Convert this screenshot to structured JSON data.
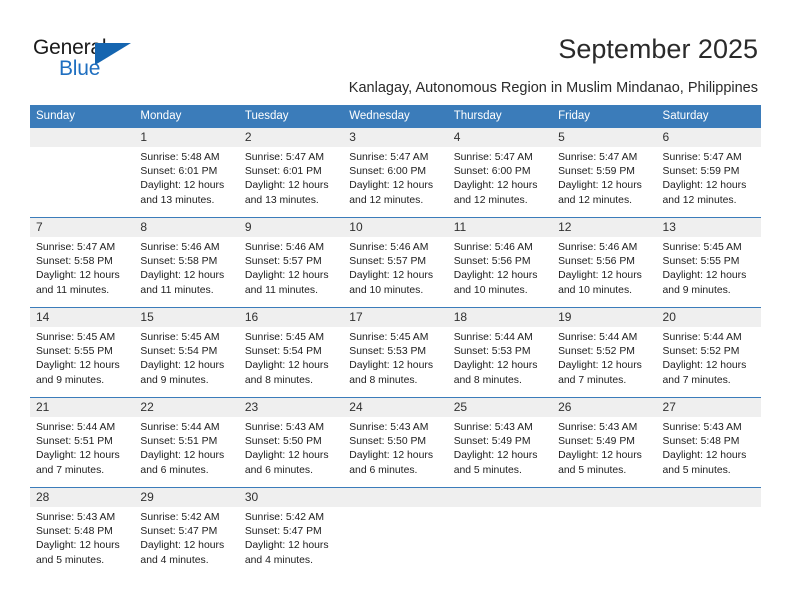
{
  "brand": {
    "name_part1": "General",
    "name_part2": "Blue"
  },
  "header": {
    "title": "September 2025",
    "subtitle": "Kanlagay, Autonomous Region in Muslim Mindanao, Philippines"
  },
  "colors": {
    "header_blue": "#3b7cba",
    "logo_blue": "#1f6fc0",
    "daynum_band": "#efefef"
  },
  "weekday_headers": [
    "Sunday",
    "Monday",
    "Tuesday",
    "Wednesday",
    "Thursday",
    "Friday",
    "Saturday"
  ],
  "weeks": [
    [
      {
        "day": "",
        "lines": []
      },
      {
        "day": "1",
        "lines": [
          "Sunrise: 5:48 AM",
          "Sunset: 6:01 PM",
          "Daylight: 12 hours",
          "and 13 minutes."
        ]
      },
      {
        "day": "2",
        "lines": [
          "Sunrise: 5:47 AM",
          "Sunset: 6:01 PM",
          "Daylight: 12 hours",
          "and 13 minutes."
        ]
      },
      {
        "day": "3",
        "lines": [
          "Sunrise: 5:47 AM",
          "Sunset: 6:00 PM",
          "Daylight: 12 hours",
          "and 12 minutes."
        ]
      },
      {
        "day": "4",
        "lines": [
          "Sunrise: 5:47 AM",
          "Sunset: 6:00 PM",
          "Daylight: 12 hours",
          "and 12 minutes."
        ]
      },
      {
        "day": "5",
        "lines": [
          "Sunrise: 5:47 AM",
          "Sunset: 5:59 PM",
          "Daylight: 12 hours",
          "and 12 minutes."
        ]
      },
      {
        "day": "6",
        "lines": [
          "Sunrise: 5:47 AM",
          "Sunset: 5:59 PM",
          "Daylight: 12 hours",
          "and 12 minutes."
        ]
      }
    ],
    [
      {
        "day": "7",
        "lines": [
          "Sunrise: 5:47 AM",
          "Sunset: 5:58 PM",
          "Daylight: 12 hours",
          "and 11 minutes."
        ]
      },
      {
        "day": "8",
        "lines": [
          "Sunrise: 5:46 AM",
          "Sunset: 5:58 PM",
          "Daylight: 12 hours",
          "and 11 minutes."
        ]
      },
      {
        "day": "9",
        "lines": [
          "Sunrise: 5:46 AM",
          "Sunset: 5:57 PM",
          "Daylight: 12 hours",
          "and 11 minutes."
        ]
      },
      {
        "day": "10",
        "lines": [
          "Sunrise: 5:46 AM",
          "Sunset: 5:57 PM",
          "Daylight: 12 hours",
          "and 10 minutes."
        ]
      },
      {
        "day": "11",
        "lines": [
          "Sunrise: 5:46 AM",
          "Sunset: 5:56 PM",
          "Daylight: 12 hours",
          "and 10 minutes."
        ]
      },
      {
        "day": "12",
        "lines": [
          "Sunrise: 5:46 AM",
          "Sunset: 5:56 PM",
          "Daylight: 12 hours",
          "and 10 minutes."
        ]
      },
      {
        "day": "13",
        "lines": [
          "Sunrise: 5:45 AM",
          "Sunset: 5:55 PM",
          "Daylight: 12 hours",
          "and 9 minutes."
        ]
      }
    ],
    [
      {
        "day": "14",
        "lines": [
          "Sunrise: 5:45 AM",
          "Sunset: 5:55 PM",
          "Daylight: 12 hours",
          "and 9 minutes."
        ]
      },
      {
        "day": "15",
        "lines": [
          "Sunrise: 5:45 AM",
          "Sunset: 5:54 PM",
          "Daylight: 12 hours",
          "and 9 minutes."
        ]
      },
      {
        "day": "16",
        "lines": [
          "Sunrise: 5:45 AM",
          "Sunset: 5:54 PM",
          "Daylight: 12 hours",
          "and 8 minutes."
        ]
      },
      {
        "day": "17",
        "lines": [
          "Sunrise: 5:45 AM",
          "Sunset: 5:53 PM",
          "Daylight: 12 hours",
          "and 8 minutes."
        ]
      },
      {
        "day": "18",
        "lines": [
          "Sunrise: 5:44 AM",
          "Sunset: 5:53 PM",
          "Daylight: 12 hours",
          "and 8 minutes."
        ]
      },
      {
        "day": "19",
        "lines": [
          "Sunrise: 5:44 AM",
          "Sunset: 5:52 PM",
          "Daylight: 12 hours",
          "and 7 minutes."
        ]
      },
      {
        "day": "20",
        "lines": [
          "Sunrise: 5:44 AM",
          "Sunset: 5:52 PM",
          "Daylight: 12 hours",
          "and 7 minutes."
        ]
      }
    ],
    [
      {
        "day": "21",
        "lines": [
          "Sunrise: 5:44 AM",
          "Sunset: 5:51 PM",
          "Daylight: 12 hours",
          "and 7 minutes."
        ]
      },
      {
        "day": "22",
        "lines": [
          "Sunrise: 5:44 AM",
          "Sunset: 5:51 PM",
          "Daylight: 12 hours",
          "and 6 minutes."
        ]
      },
      {
        "day": "23",
        "lines": [
          "Sunrise: 5:43 AM",
          "Sunset: 5:50 PM",
          "Daylight: 12 hours",
          "and 6 minutes."
        ]
      },
      {
        "day": "24",
        "lines": [
          "Sunrise: 5:43 AM",
          "Sunset: 5:50 PM",
          "Daylight: 12 hours",
          "and 6 minutes."
        ]
      },
      {
        "day": "25",
        "lines": [
          "Sunrise: 5:43 AM",
          "Sunset: 5:49 PM",
          "Daylight: 12 hours",
          "and 5 minutes."
        ]
      },
      {
        "day": "26",
        "lines": [
          "Sunrise: 5:43 AM",
          "Sunset: 5:49 PM",
          "Daylight: 12 hours",
          "and 5 minutes."
        ]
      },
      {
        "day": "27",
        "lines": [
          "Sunrise: 5:43 AM",
          "Sunset: 5:48 PM",
          "Daylight: 12 hours",
          "and 5 minutes."
        ]
      }
    ],
    [
      {
        "day": "28",
        "lines": [
          "Sunrise: 5:43 AM",
          "Sunset: 5:48 PM",
          "Daylight: 12 hours",
          "and 5 minutes."
        ]
      },
      {
        "day": "29",
        "lines": [
          "Sunrise: 5:42 AM",
          "Sunset: 5:47 PM",
          "Daylight: 12 hours",
          "and 4 minutes."
        ]
      },
      {
        "day": "30",
        "lines": [
          "Sunrise: 5:42 AM",
          "Sunset: 5:47 PM",
          "Daylight: 12 hours",
          "and 4 minutes."
        ]
      },
      {
        "day": "",
        "lines": []
      },
      {
        "day": "",
        "lines": []
      },
      {
        "day": "",
        "lines": []
      },
      {
        "day": "",
        "lines": []
      }
    ]
  ]
}
